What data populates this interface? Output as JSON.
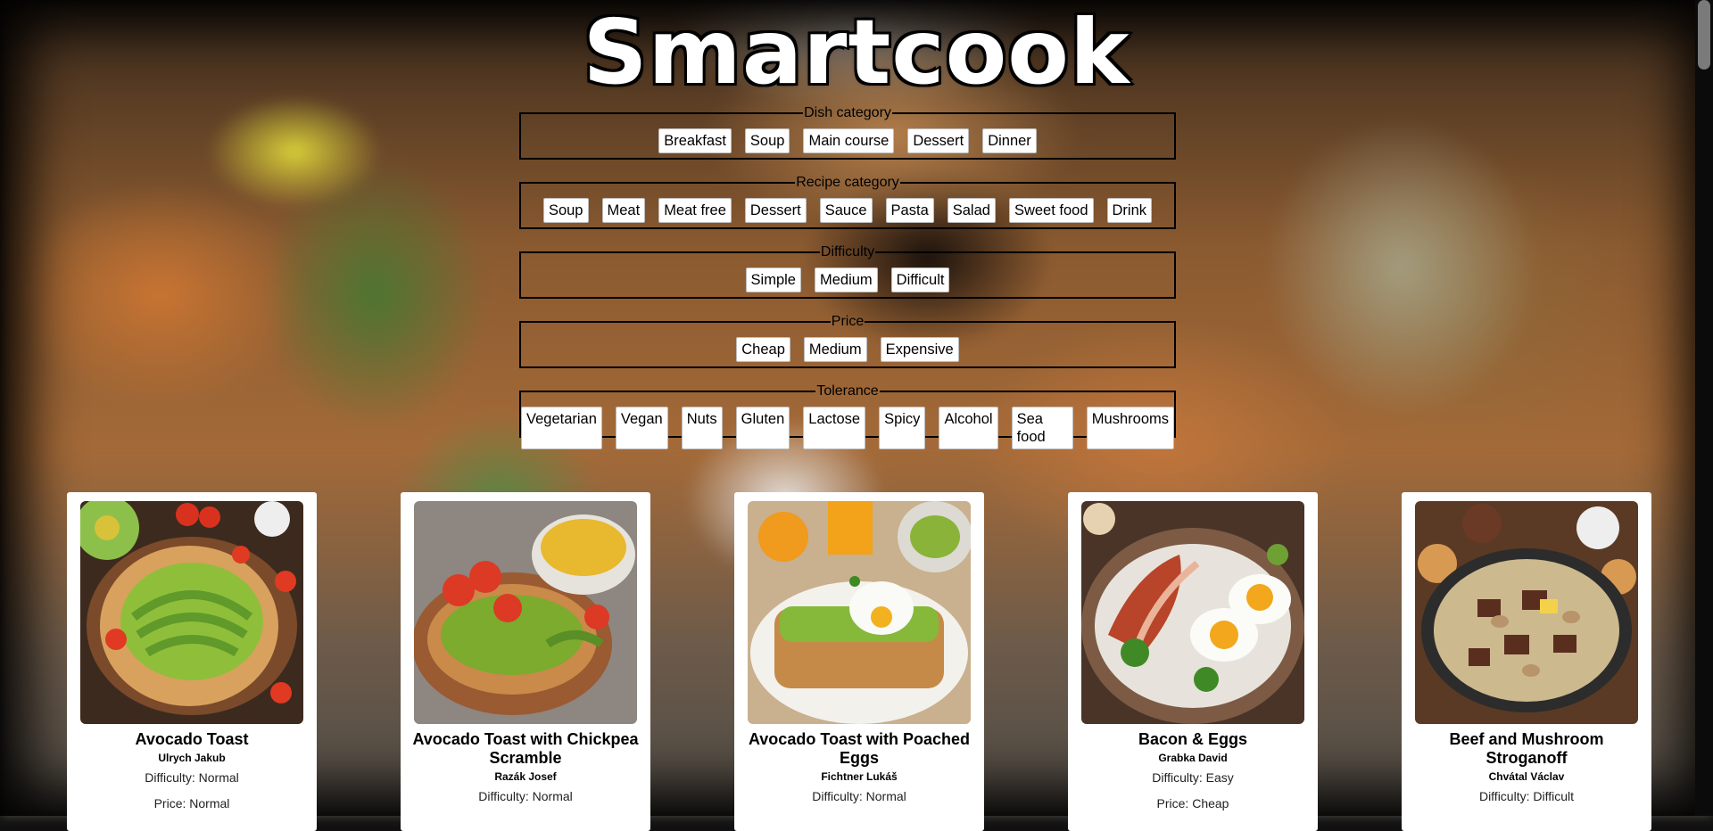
{
  "app": {
    "title": "Smartcook"
  },
  "filters": [
    {
      "legend": "Dish category",
      "options": [
        "Breakfast",
        "Soup",
        "Main course",
        "Dessert",
        "Dinner"
      ]
    },
    {
      "legend": "Recipe category",
      "options": [
        "Soup",
        "Meat",
        "Meat free",
        "Dessert",
        "Sauce",
        "Pasta",
        "Salad",
        "Sweet food",
        "Drink"
      ]
    },
    {
      "legend": "Difficulty",
      "options": [
        "Simple",
        "Medium",
        "Difficult"
      ]
    },
    {
      "legend": "Price",
      "options": [
        "Cheap",
        "Medium",
        "Expensive"
      ]
    },
    {
      "legend": "Tolerance",
      "options": [
        "Vegetarian",
        "Vegan",
        "Nuts",
        "Gluten",
        "Lactose",
        "Spicy",
        "Alcohol",
        "Sea food",
        "Mushrooms"
      ]
    }
  ],
  "recipes": [
    {
      "title": "Avocado Toast",
      "author": "Ulrych Jakub",
      "difficulty": "Difficulty: Normal",
      "price": "Price: Normal",
      "image": "avocado-toast-photo"
    },
    {
      "title": "Avocado Toast with Chickpea Scramble",
      "author": "Razák Josef",
      "difficulty": "Difficulty: Normal",
      "price": "",
      "image": "avocado-chickpea-photo"
    },
    {
      "title": "Avocado Toast with Poached Eggs",
      "author": "Fichtner Lukáš",
      "difficulty": "Difficulty: Normal",
      "price": "",
      "image": "avocado-poached-egg-photo"
    },
    {
      "title": "Bacon & Eggs",
      "author": "Grabka David",
      "difficulty": "Difficulty: Easy",
      "price": "Price: Cheap",
      "image": "bacon-eggs-photo"
    },
    {
      "title": "Beef and Mushroom Stroganoff",
      "author": "Chvátal Václav",
      "difficulty": "Difficulty: Difficult",
      "price": "",
      "image": "beef-stroganoff-photo"
    }
  ]
}
